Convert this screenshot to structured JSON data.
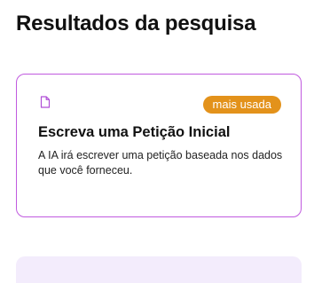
{
  "page": {
    "title": "Resultados da pesquisa"
  },
  "results": [
    {
      "icon": "document-icon",
      "badge": "mais usada",
      "title": "Escreva uma Petição Inicial",
      "description": "A IA irá escrever uma petição baseada nos dados que você forneceu."
    }
  ],
  "colors": {
    "card_border": "#c05adf",
    "icon": "#b04fd6",
    "badge_background": "#e3921b",
    "next_card_background": "#f3ecfc"
  }
}
